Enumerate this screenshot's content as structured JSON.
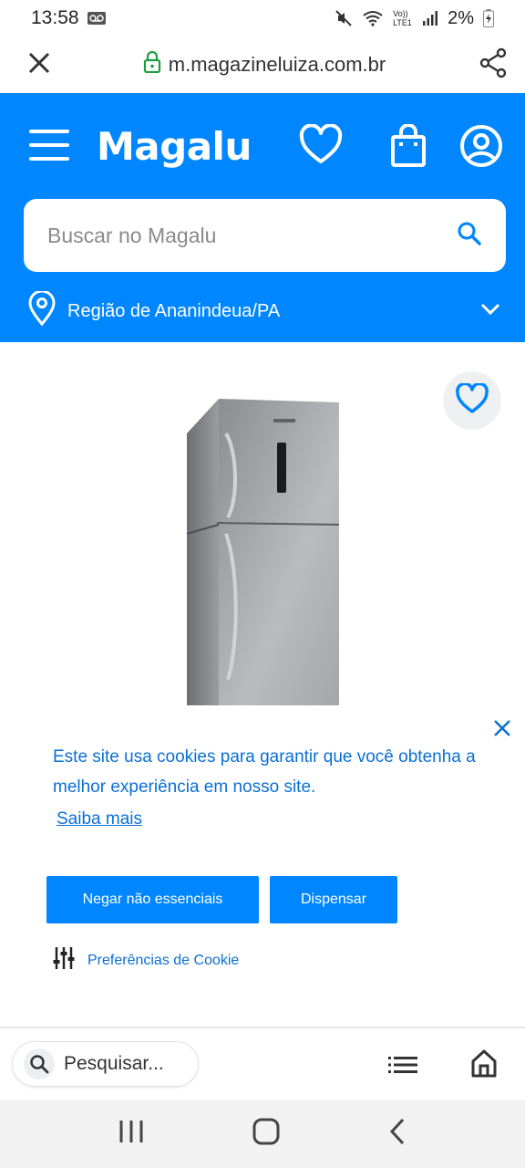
{
  "status_bar": {
    "time": "13:58",
    "network_label": "Vo)) LTE1",
    "battery": "2%"
  },
  "browser": {
    "url": "m.magazineluiza.com.br"
  },
  "header": {
    "logo": "Magalu",
    "search_placeholder": "Buscar no Magalu",
    "region": "Região de Ananindeua/PA",
    "brand_color": "#0086ff"
  },
  "cookie": {
    "message": "Este site usa cookies para garantir que você obtenha a melhor experiência em nosso site.",
    "learn_more": "Saiba mais",
    "deny_button": "Negar não essenciais",
    "dismiss_button": "Dispensar",
    "preferences": "Preferências de Cookie"
  },
  "bottom_bar": {
    "search_label": "Pesquisar..."
  }
}
